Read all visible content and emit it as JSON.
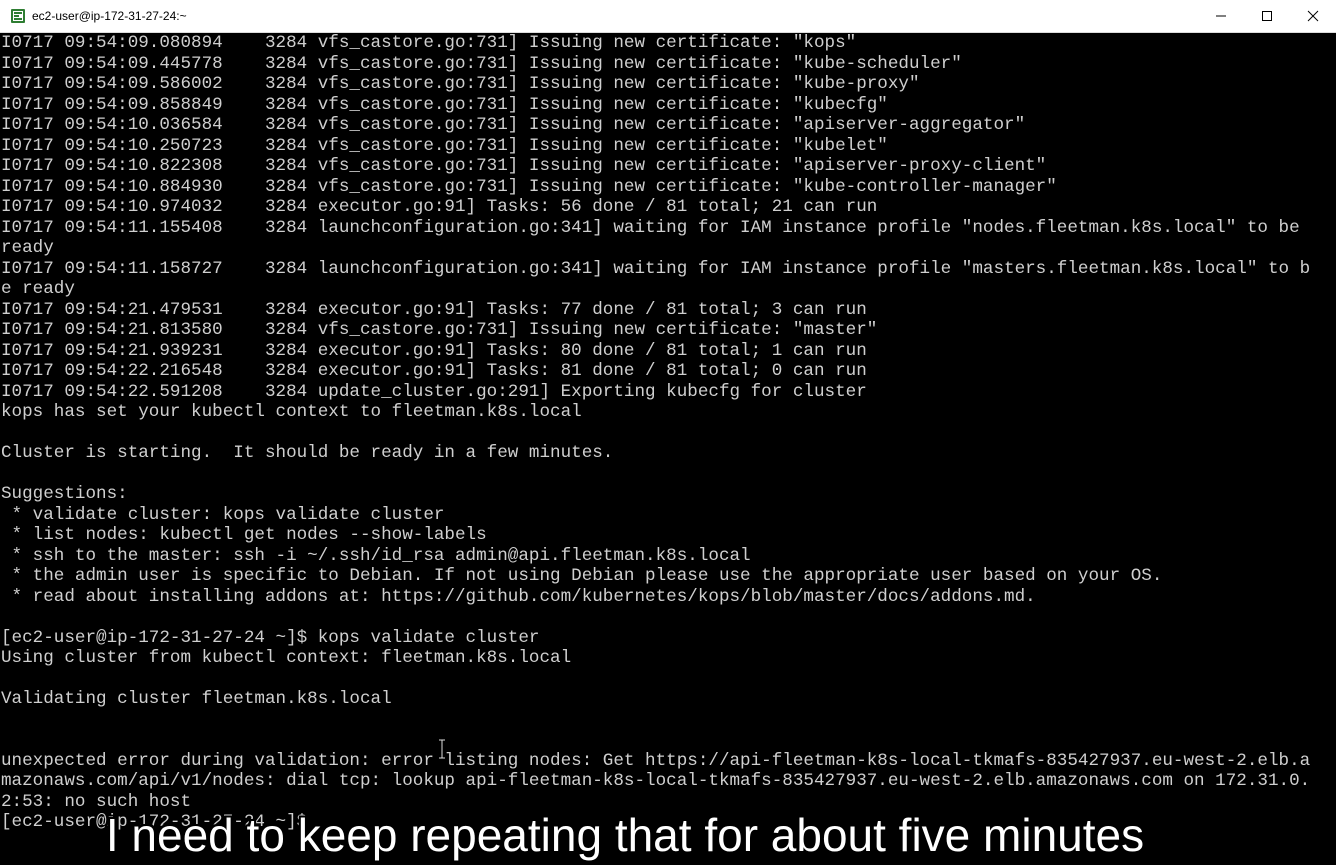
{
  "window": {
    "title": "ec2-user@ip-172-31-27-24:~",
    "app_icon": "terminal-app-icon",
    "controls": {
      "minimize_icon": "minimize-icon",
      "maximize_icon": "maximize-icon",
      "close_icon": "close-icon"
    }
  },
  "colors": {
    "terminal_background": "#000000",
    "terminal_text": "#cfcfcf",
    "titlebar_background": "#ffffff",
    "subtitle_text": "#ffffff"
  },
  "terminal": {
    "lines": [
      "I0717 09:54:09.080894    3284 vfs_castore.go:731] Issuing new certificate: \"kops\"",
      "I0717 09:54:09.445778    3284 vfs_castore.go:731] Issuing new certificate: \"kube-scheduler\"",
      "I0717 09:54:09.586002    3284 vfs_castore.go:731] Issuing new certificate: \"kube-proxy\"",
      "I0717 09:54:09.858849    3284 vfs_castore.go:731] Issuing new certificate: \"kubecfg\"",
      "I0717 09:54:10.036584    3284 vfs_castore.go:731] Issuing new certificate: \"apiserver-aggregator\"",
      "I0717 09:54:10.250723    3284 vfs_castore.go:731] Issuing new certificate: \"kubelet\"",
      "I0717 09:54:10.822308    3284 vfs_castore.go:731] Issuing new certificate: \"apiserver-proxy-client\"",
      "I0717 09:54:10.884930    3284 vfs_castore.go:731] Issuing new certificate: \"kube-controller-manager\"",
      "I0717 09:54:10.974032    3284 executor.go:91] Tasks: 56 done / 81 total; 21 can run",
      "I0717 09:54:11.155408    3284 launchconfiguration.go:341] waiting for IAM instance profile \"nodes.fleetman.k8s.local\" to be",
      "ready",
      "I0717 09:54:11.158727    3284 launchconfiguration.go:341] waiting for IAM instance profile \"masters.fleetman.k8s.local\" to b",
      "e ready",
      "I0717 09:54:21.479531    3284 executor.go:91] Tasks: 77 done / 81 total; 3 can run",
      "I0717 09:54:21.813580    3284 vfs_castore.go:731] Issuing new certificate: \"master\"",
      "I0717 09:54:21.939231    3284 executor.go:91] Tasks: 80 done / 81 total; 1 can run",
      "I0717 09:54:22.216548    3284 executor.go:91] Tasks: 81 done / 81 total; 0 can run",
      "I0717 09:54:22.591208    3284 update_cluster.go:291] Exporting kubecfg for cluster",
      "kops has set your kubectl context to fleetman.k8s.local",
      "",
      "Cluster is starting.  It should be ready in a few minutes.",
      "",
      "Suggestions:",
      " * validate cluster: kops validate cluster",
      " * list nodes: kubectl get nodes --show-labels",
      " * ssh to the master: ssh -i ~/.ssh/id_rsa admin@api.fleetman.k8s.local",
      " * the admin user is specific to Debian. If not using Debian please use the appropriate user based on your OS.",
      " * read about installing addons at: https://github.com/kubernetes/kops/blob/master/docs/addons.md.",
      "",
      "[ec2-user@ip-172-31-27-24 ~]$ kops validate cluster",
      "Using cluster from kubectl context: fleetman.k8s.local",
      "",
      "Validating cluster fleetman.k8s.local",
      "",
      "",
      "unexpected error during validation: error listing nodes: Get https://api-fleetman-k8s-local-tkmafs-835427937.eu-west-2.elb.a",
      "mazonaws.com/api/v1/nodes: dial tcp: lookup api-fleetman-k8s-local-tkmafs-835427937.eu-west-2.elb.amazonaws.com on 172.31.0.",
      "2:53: no such host",
      "[ec2-user@ip-172-31-27-24 ~]$ "
    ]
  },
  "subtitle": {
    "text": "I need to keep repeating that for about five minutes"
  }
}
